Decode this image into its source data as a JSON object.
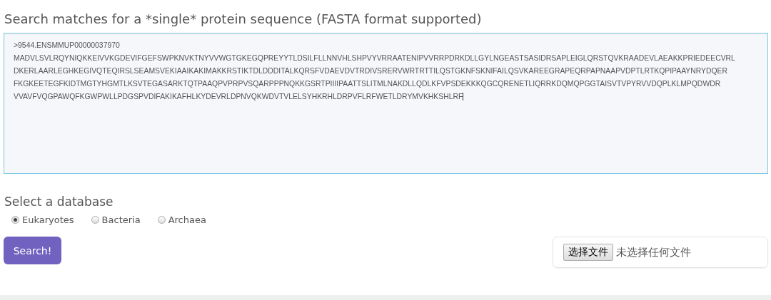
{
  "heading": "Search matches for a *single* protein sequence (FASTA format supported)",
  "sequence": {
    "value_lines": [
      ">9544.ENSMMUP00000037970",
      "MADVLSVLRQYNIQKKEIVVKGDEVIFGEFSWPKNVKTNYVVWGTGKEGQPREYYTLDSILFLLNNVHLSHPVYVRRAATENIPVVRRPDRKDLLGYLNGEASTSASIDRSAPLEIGLQRSTQVKRAADEVLAEAKKPRIEDEECVRL",
      "DKERLAARLEGHKEGIVQTEQIRSLSEAMSVEKIAAIKAKIMAKKRSTIKTDLDDDITALKQRSFVDAEVDVTRDIVSRERVWRTRTTILQSTGKNFSKNIFAILQSVKAREEGRAPEQRPAPNAAPVDPTLRTKQPIPAAYNRYDQER",
      "FKGKEETEGFKIDTMGTYHGMTLKSVTEGASARKTQTPAAQPVPRPVSQARPPPNQKKGSRTPIIIIPAATTSLITMLNAKDLLQDLKFVPSDEKKKQGCQRENETLIQRRKDQMQPGGTAISVTVPYRVVDQPLKLMPQDWDR",
      "VVAVFVQGPAWQFKGWPWLLPDGSPVDIFAKIKAFHLKYDEVRLDPNVQKWDVTVLELSYHKRHLDRPVFLRFWETLDRYMVKHKSHLRF"
    ]
  },
  "database": {
    "label": "Select a database",
    "options": [
      {
        "label": "Eukaryotes",
        "selected": true
      },
      {
        "label": "Bacteria",
        "selected": false
      },
      {
        "label": "Archaea",
        "selected": false
      }
    ]
  },
  "search_button": "Search!",
  "file_input": {
    "button": "选择文件",
    "status": "未选择任何文件"
  }
}
